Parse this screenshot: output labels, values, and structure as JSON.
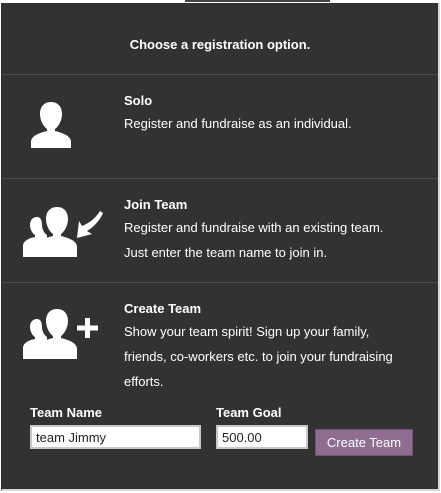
{
  "header": {
    "title": "Choose a registration option."
  },
  "options": [
    {
      "title": "Solo",
      "lines": [
        "Register and fundraise as an individual."
      ],
      "icon": "single-person-icon"
    },
    {
      "title": "Join Team",
      "lines": [
        "Register and fundraise with an existing team.",
        "Just enter the team name to join in."
      ],
      "icon": "join-team-icon"
    },
    {
      "title": "Create Team",
      "lines": [
        "Show your team spirit! Sign up your family,",
        "friends, co-workers etc. to join your fundraising",
        "efforts."
      ],
      "icon": "create-team-icon"
    }
  ],
  "form": {
    "team_name_label": "Team Name",
    "team_name_value": "team Jimmy",
    "team_goal_label": "Team Goal",
    "team_goal_value": "500.00",
    "create_button": "Create Team"
  },
  "colors": {
    "panel": "#333232",
    "button": "#8e6d91",
    "text": "#ffffff"
  }
}
